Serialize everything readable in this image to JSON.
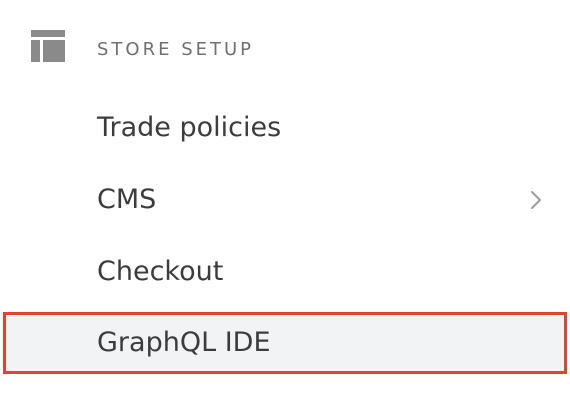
{
  "section": {
    "title": "STORE SETUP",
    "icon": "layout-icon"
  },
  "menu": {
    "items": [
      {
        "label": "Trade policies",
        "has_chevron": false
      },
      {
        "label": "CMS",
        "has_chevron": true,
        "chevron_icon": "chevron-right-icon"
      },
      {
        "label": "Checkout",
        "has_chevron": false
      },
      {
        "label": "GraphQL IDE",
        "has_chevron": false,
        "highlighted": true
      }
    ]
  },
  "colors": {
    "highlight_border": "#e0452b",
    "highlight_background": "#f2f3f5",
    "text": "#3c3c3c",
    "section_title": "#6f6f6f",
    "icon": "#8a8a8a"
  }
}
